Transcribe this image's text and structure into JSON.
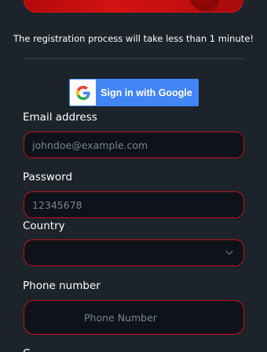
{
  "notice": "The registration process will take less than 1 minute!",
  "google_button": {
    "label": "Sign in with Google",
    "icon": "google-g-icon"
  },
  "email": {
    "label": "Email address",
    "placeholder": "johndoe@example.com",
    "value": ""
  },
  "password": {
    "label": "Password",
    "placeholder": "12345678",
    "value": ""
  },
  "country": {
    "label": "Country",
    "selected": "",
    "icon": "chevron-down-icon"
  },
  "phone": {
    "label": "Phone number",
    "placeholder": "Phone Number",
    "value": ""
  },
  "next_label_partial": "C",
  "colors": {
    "background": "#1c232b",
    "field_background": "#0e1219",
    "field_border": "#c0121b",
    "google_blue": "#4285f4",
    "banner_red": "#c60f0f"
  }
}
